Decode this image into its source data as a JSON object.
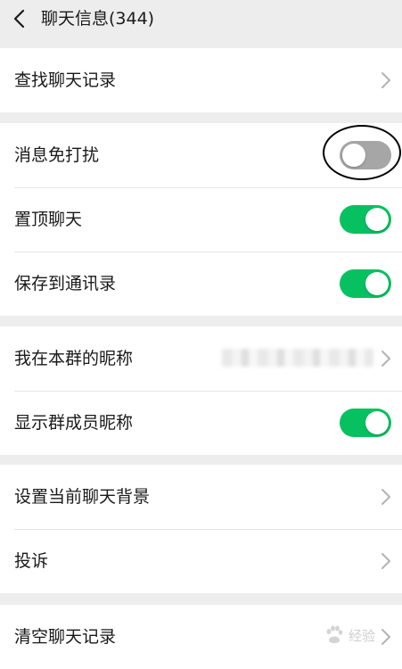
{
  "header": {
    "title": "聊天信息(344)",
    "back_icon": "chevron-left-icon"
  },
  "groups": [
    {
      "items": [
        {
          "label": "查找聊天记录",
          "type": "link"
        }
      ]
    },
    {
      "items": [
        {
          "label": "消息免打扰",
          "type": "toggle",
          "on": false
        },
        {
          "label": "置顶聊天",
          "type": "toggle",
          "on": true
        },
        {
          "label": "保存到通讯录",
          "type": "toggle",
          "on": true
        }
      ]
    },
    {
      "items": [
        {
          "label": "我在本群的昵称",
          "type": "link",
          "value_blurred": true
        },
        {
          "label": "显示群成员昵称",
          "type": "toggle",
          "on": true
        }
      ]
    },
    {
      "items": [
        {
          "label": "设置当前聊天背景",
          "type": "link"
        },
        {
          "label": "投诉",
          "type": "link"
        }
      ]
    },
    {
      "items": [
        {
          "label": "清空聊天记录",
          "type": "link"
        }
      ]
    }
  ],
  "watermark": {
    "text": "经验",
    "icon": "baidu-paw-icon"
  },
  "colors": {
    "toggle_on": "#07c160",
    "toggle_off": "#a6a6a6",
    "background": "#ededed"
  }
}
